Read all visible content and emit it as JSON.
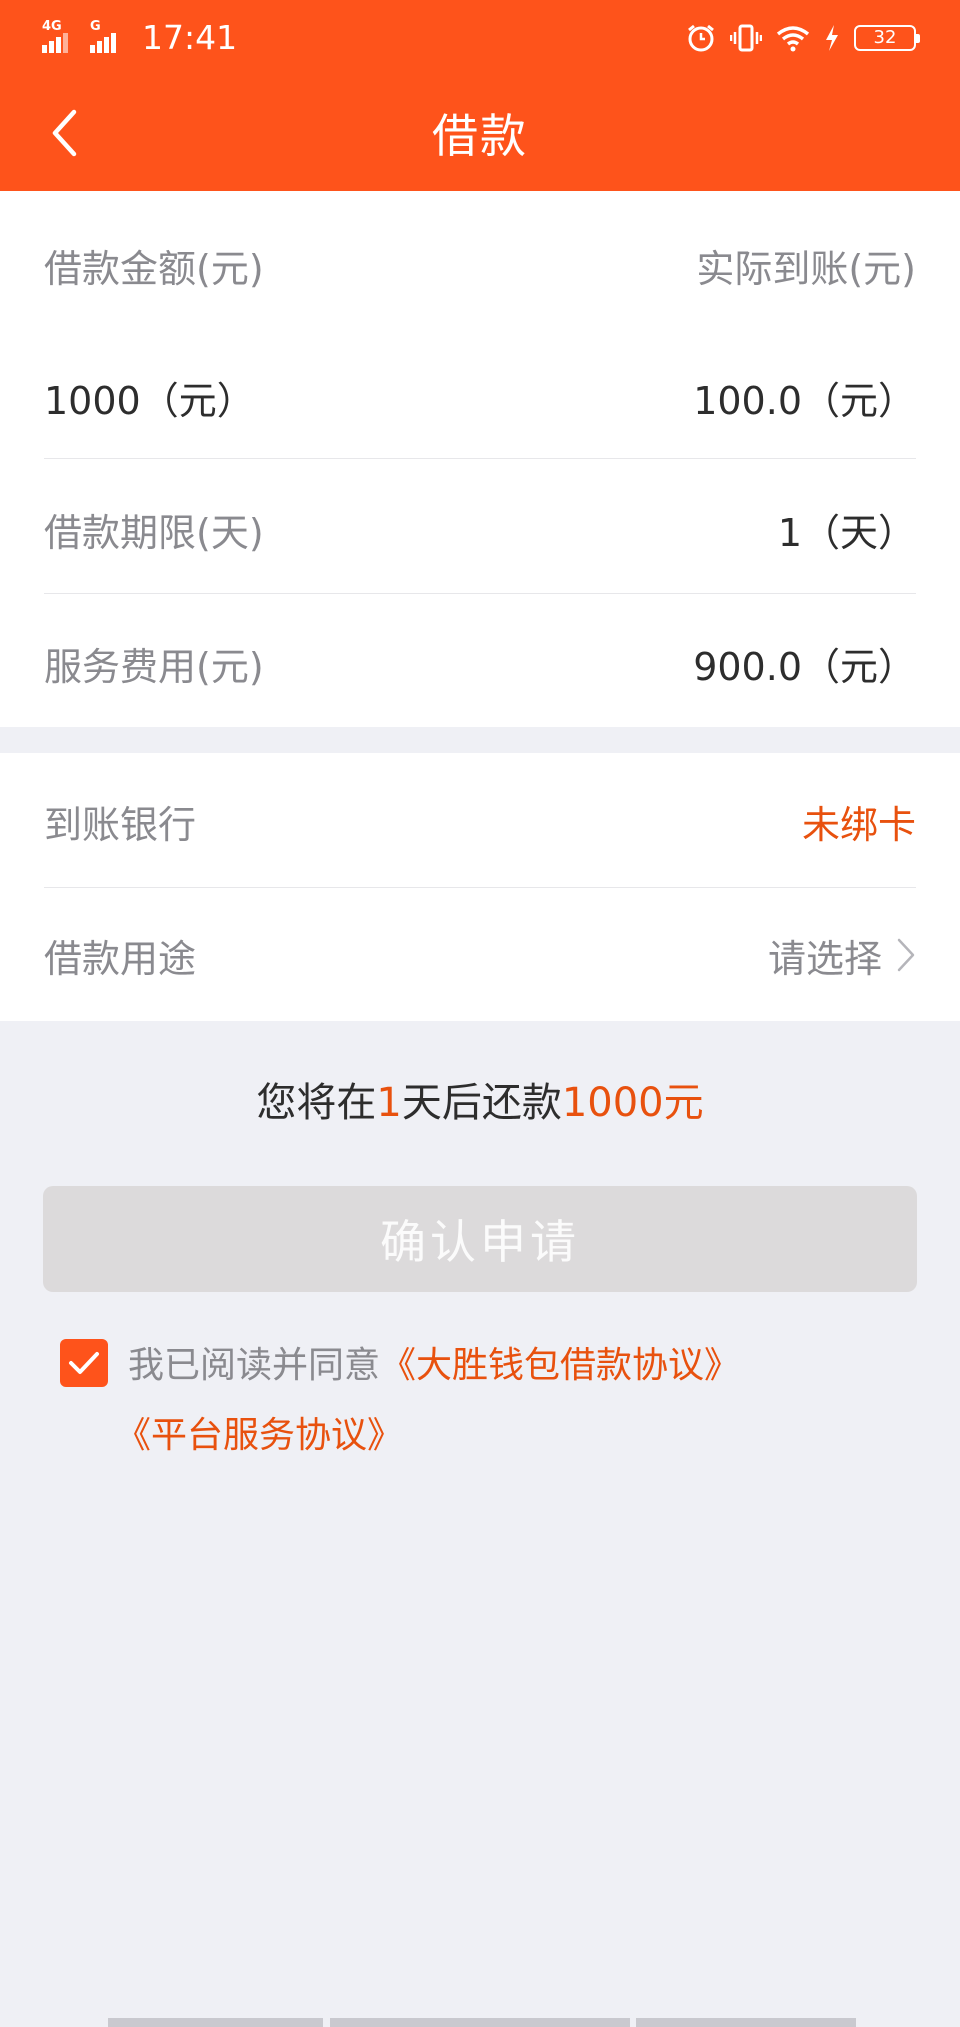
{
  "status": {
    "network1": "4G",
    "network2": "G",
    "time": "17:41",
    "battery": "32"
  },
  "nav": {
    "title": "借款"
  },
  "loan": {
    "amount_label": "借款金额(元)",
    "received_label": "实际到账(元)",
    "amount_value": "1000（元）",
    "received_value": "100.0（元）",
    "term_label": "借款期限(天)",
    "term_value": "1（天）",
    "fee_label": "服务费用(元)",
    "fee_value": "900.0（元）"
  },
  "bank": {
    "label": "到账银行",
    "value": "未绑卡",
    "purpose_label": "借款用途",
    "purpose_value": "请选择"
  },
  "repay": {
    "prefix": "您将在",
    "days": "1",
    "middle": "天后还款",
    "amount": "1000元"
  },
  "confirm_button": "确认申请",
  "agreement": {
    "checked": true,
    "text": "我已阅读并同意",
    "link1": "《大胜钱包借款协议》",
    "link2": "《平台服务协议》"
  },
  "colors": {
    "brand": "#fe531b",
    "accent_text": "#e8510e",
    "background": "#eff0f5",
    "disabled_button": "#dcdadb"
  }
}
